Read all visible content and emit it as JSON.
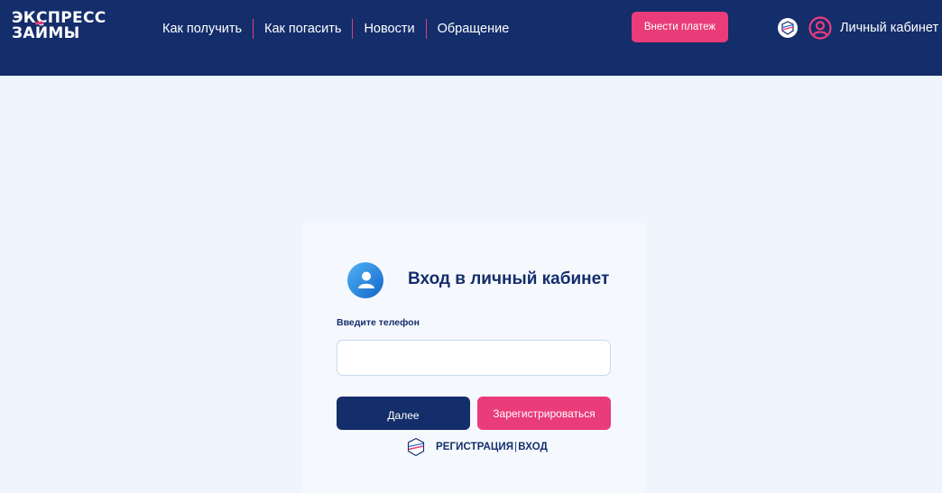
{
  "header": {
    "logo": {
      "line1": "ЭКСПРЕСС",
      "line2": "ЗАЙМЫ"
    },
    "nav": [
      {
        "label": "Как получить"
      },
      {
        "label": "Как погасить"
      },
      {
        "label": "Новости"
      },
      {
        "label": "Обращение"
      }
    ],
    "pay_button": "Внести платеж",
    "gos_icon": "gosuslugi-icon",
    "cabinet_icon": "user-circle-icon",
    "cabinet_label": "Личный кабинет"
  },
  "login": {
    "avatar_icon": "user-avatar-icon",
    "title": "Вход в личный кабинет",
    "phone_label": "Введите телефон",
    "phone_value": "",
    "phone_placeholder": "",
    "next_button": "Далее",
    "register_button": "Зарегистрироваться",
    "gos_row": {
      "icon": "gosuslugi-icon",
      "register": "РЕГИСТРАЦИЯ",
      "separator": "|",
      "login": "ВХОД"
    }
  },
  "colors": {
    "header_bg": "#142d6b",
    "accent": "#ea3c79",
    "page_bg": "#eef5fd",
    "card_bg": "#f5f9fe",
    "primary_text": "#142d6b"
  }
}
